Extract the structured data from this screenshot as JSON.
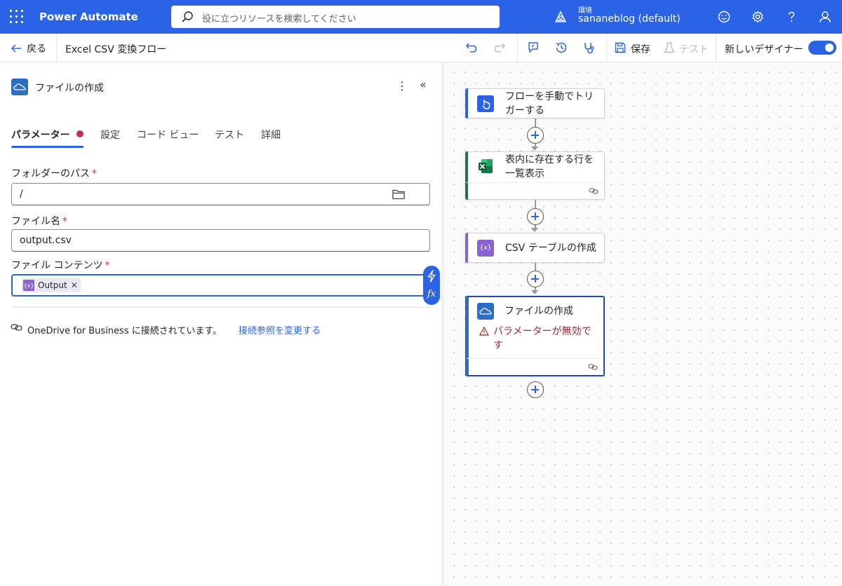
{
  "app": {
    "title": "Power Automate",
    "search_placeholder": "役に立つリソースを検索してください",
    "environment_label": "環境",
    "environment_name": "sananeblog (default)"
  },
  "commandbar": {
    "back_label": "戻る",
    "flow_name": "Excel CSV 変換フロー",
    "save_label": "保存",
    "test_label": "テスト",
    "new_designer_label": "新しいデザイナー",
    "new_designer_on": true
  },
  "panel": {
    "title": "ファイルの作成",
    "tabs": [
      {
        "label": "パラメーター",
        "active": true,
        "has_error": true
      },
      {
        "label": "設定"
      },
      {
        "label": "コード ビュー"
      },
      {
        "label": "テスト"
      },
      {
        "label": "詳細"
      }
    ],
    "fields": {
      "folder_path": {
        "label": "フォルダーのパス",
        "required_mark": "*",
        "value": "/"
      },
      "file_name": {
        "label": "ファイル名",
        "required_mark": "*",
        "value": "output.csv"
      },
      "file_content": {
        "label": "ファイル コンテンツ",
        "required_mark": "*",
        "token": "Output"
      }
    },
    "connection_text": "OneDrive for Business に接続されています。",
    "connection_link": "接続参照を変更する"
  },
  "flow": {
    "nodes": [
      {
        "title": "フローを手動でトリガーする",
        "accent": "#2b63e6"
      },
      {
        "title": "表内に存在する行を一覧表示",
        "accent": "#217346"
      },
      {
        "title": "CSV テーブルの作成",
        "accent": "#8a63d2"
      },
      {
        "title": "ファイルの作成",
        "accent": "#2d6fc7",
        "warning": "パラメーターが無効です"
      }
    ]
  },
  "colors": {
    "brand": "#2b63e6",
    "error": "#c4314b"
  }
}
